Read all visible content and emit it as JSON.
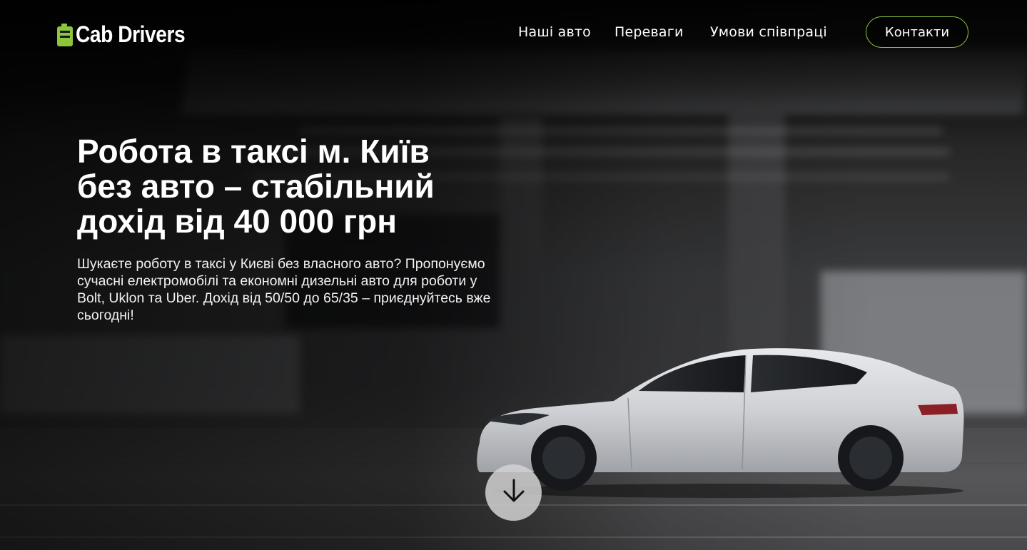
{
  "brand": {
    "name": "Cab Drivers",
    "accent_color": "#8cc63f"
  },
  "nav": {
    "items": [
      {
        "label": "Наші авто"
      },
      {
        "label": "Переваги"
      },
      {
        "label": "Умови співпраці"
      }
    ],
    "contact_label": "Контакти"
  },
  "hero": {
    "title": "Робота в таксі м. Київ без авто – стабільний дохід від 40 000 грн",
    "description": "Шукаєте роботу в таксі у Києві без власного авто? Пропонуємо сучасні електромобілі та економні дизельні авто для роботи у Bolt, Uklon та Uber. Дохід від 50/50 до 65/35 – приєднуйтесь вже сьогодні!",
    "scroll_icon": "arrow-down-icon",
    "car_image": "white-electric-sedan"
  }
}
